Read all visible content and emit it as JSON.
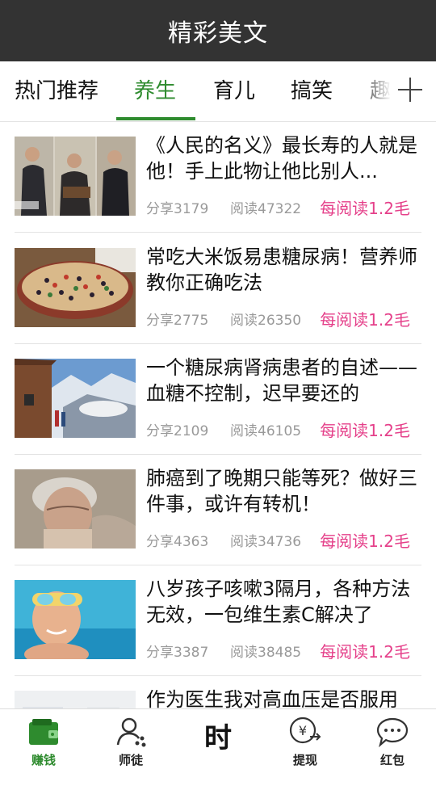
{
  "header": {
    "title": "精彩美文"
  },
  "tabs": [
    {
      "label": "热门推荐",
      "active": false
    },
    {
      "label": "养生",
      "active": true
    },
    {
      "label": "育儿",
      "active": false
    },
    {
      "label": "搞笑",
      "active": false
    },
    {
      "label": "趣",
      "active": false
    }
  ],
  "tabs_add_icon": "plus-icon",
  "articles": [
    {
      "title": "《人民的名义》最长寿的人就是他！手上此物让他比别人...",
      "share": "分享3179",
      "read": "阅读47322",
      "reward": "每阅读1.2毛"
    },
    {
      "title": "常吃大米饭易患糖尿病！营养师教你正确吃法",
      "share": "分享2775",
      "read": "阅读26350",
      "reward": "每阅读1.2毛"
    },
    {
      "title": "一个糖尿病肾病患者的自述——血糖不控制，迟早要还的",
      "share": "分享2109",
      "read": "阅读46105",
      "reward": "每阅读1.2毛"
    },
    {
      "title": "肺癌到了晚期只能等死？做好三件事，或许有转机！",
      "share": "分享4363",
      "read": "阅读34736",
      "reward": "每阅读1.2毛"
    },
    {
      "title": "八岁孩子咳嗽3隔月，各种方法无效，一包维生素C解决了",
      "share": "分享3387",
      "read": "阅读38485",
      "reward": "每阅读1.2毛"
    },
    {
      "title": "作为医生我对高血压是否服用",
      "share": "",
      "read": "",
      "reward": ""
    }
  ],
  "bottom_nav": [
    {
      "label": "赚钱",
      "icon": "wallet-icon",
      "active": true
    },
    {
      "label": "师徒",
      "icon": "user-share-icon",
      "active": false
    },
    {
      "label": "时",
      "icon": "time-char-icon",
      "active": false
    },
    {
      "label": "提现",
      "icon": "yuan-coin-icon",
      "active": false
    },
    {
      "label": "红包",
      "icon": "chat-bubble-icon",
      "active": false
    }
  ],
  "colors": {
    "accent": "#2e8b2e",
    "reward": "#e5408a",
    "header_bg": "#333333"
  }
}
